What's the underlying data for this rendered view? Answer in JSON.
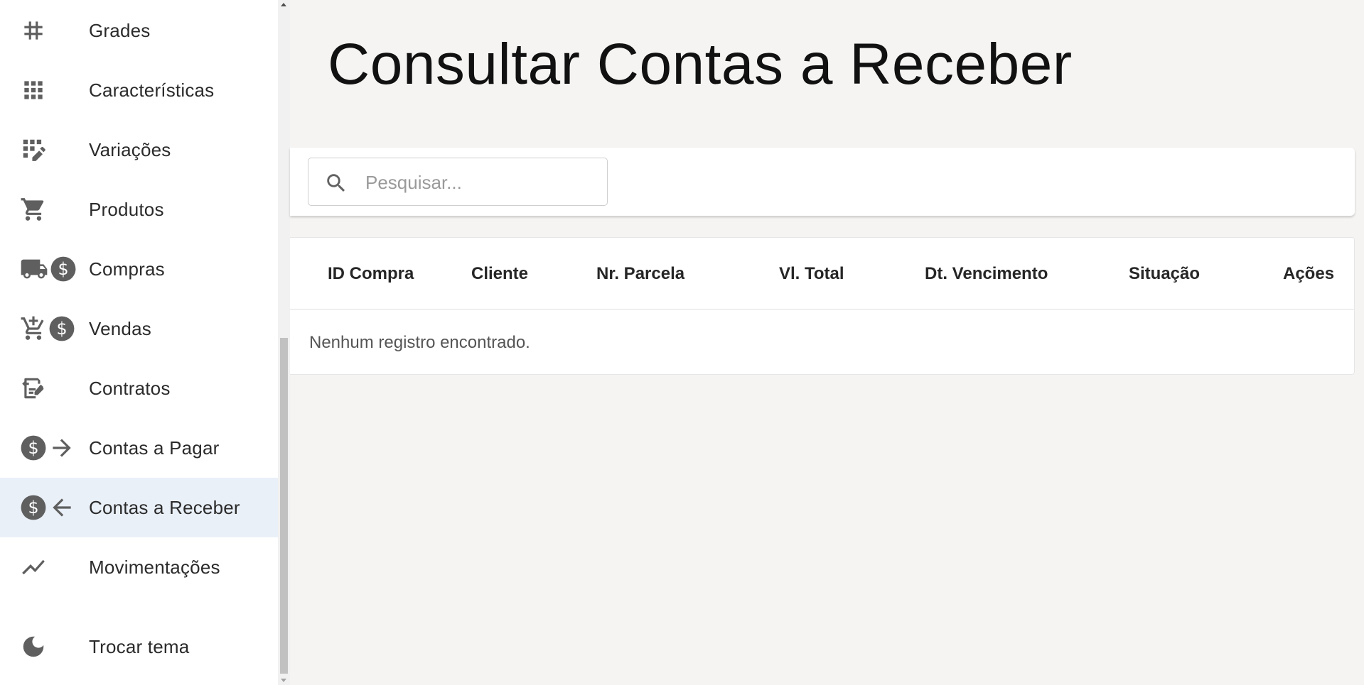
{
  "sidebar": {
    "items": [
      {
        "label": "Grades",
        "icons": [
          "hash-icon"
        ]
      },
      {
        "label": "Características",
        "icons": [
          "grid-icon"
        ]
      },
      {
        "label": "Variações",
        "icons": [
          "grid-edit-icon"
        ]
      },
      {
        "label": "Produtos",
        "icons": [
          "shopping-cart-icon"
        ]
      },
      {
        "label": "Compras",
        "icons": [
          "truck-icon",
          "dollar-circle-icon"
        ]
      },
      {
        "label": "Vendas",
        "icons": [
          "add-cart-icon",
          "dollar-circle-icon"
        ]
      },
      {
        "label": "Contratos",
        "icons": [
          "contract-icon"
        ]
      },
      {
        "label": "Contas a Pagar",
        "icons": [
          "dollar-circle-icon",
          "arrow-right-icon"
        ]
      },
      {
        "label": "Contas a Receber",
        "icons": [
          "dollar-circle-icon",
          "arrow-left-icon"
        ],
        "active": true
      },
      {
        "label": "Movimentações",
        "icons": [
          "trending-line-icon"
        ]
      }
    ],
    "theme_toggle": {
      "label": "Trocar tema",
      "icon": "moon-icon"
    }
  },
  "main": {
    "title": "Consultar Contas a Receber",
    "search": {
      "placeholder": "Pesquisar...",
      "value": ""
    },
    "table": {
      "columns": [
        "ID Compra",
        "Cliente",
        "Nr. Parcela",
        "Vl. Total",
        "Dt. Vencimento",
        "Situação",
        "Ações"
      ],
      "empty_message": "Nenhum registro encontrado."
    }
  },
  "colors": {
    "active_item_bg": "#eaf0f8",
    "page_bg": "#f5f4f2",
    "icon_gray": "#5f5f5f"
  }
}
